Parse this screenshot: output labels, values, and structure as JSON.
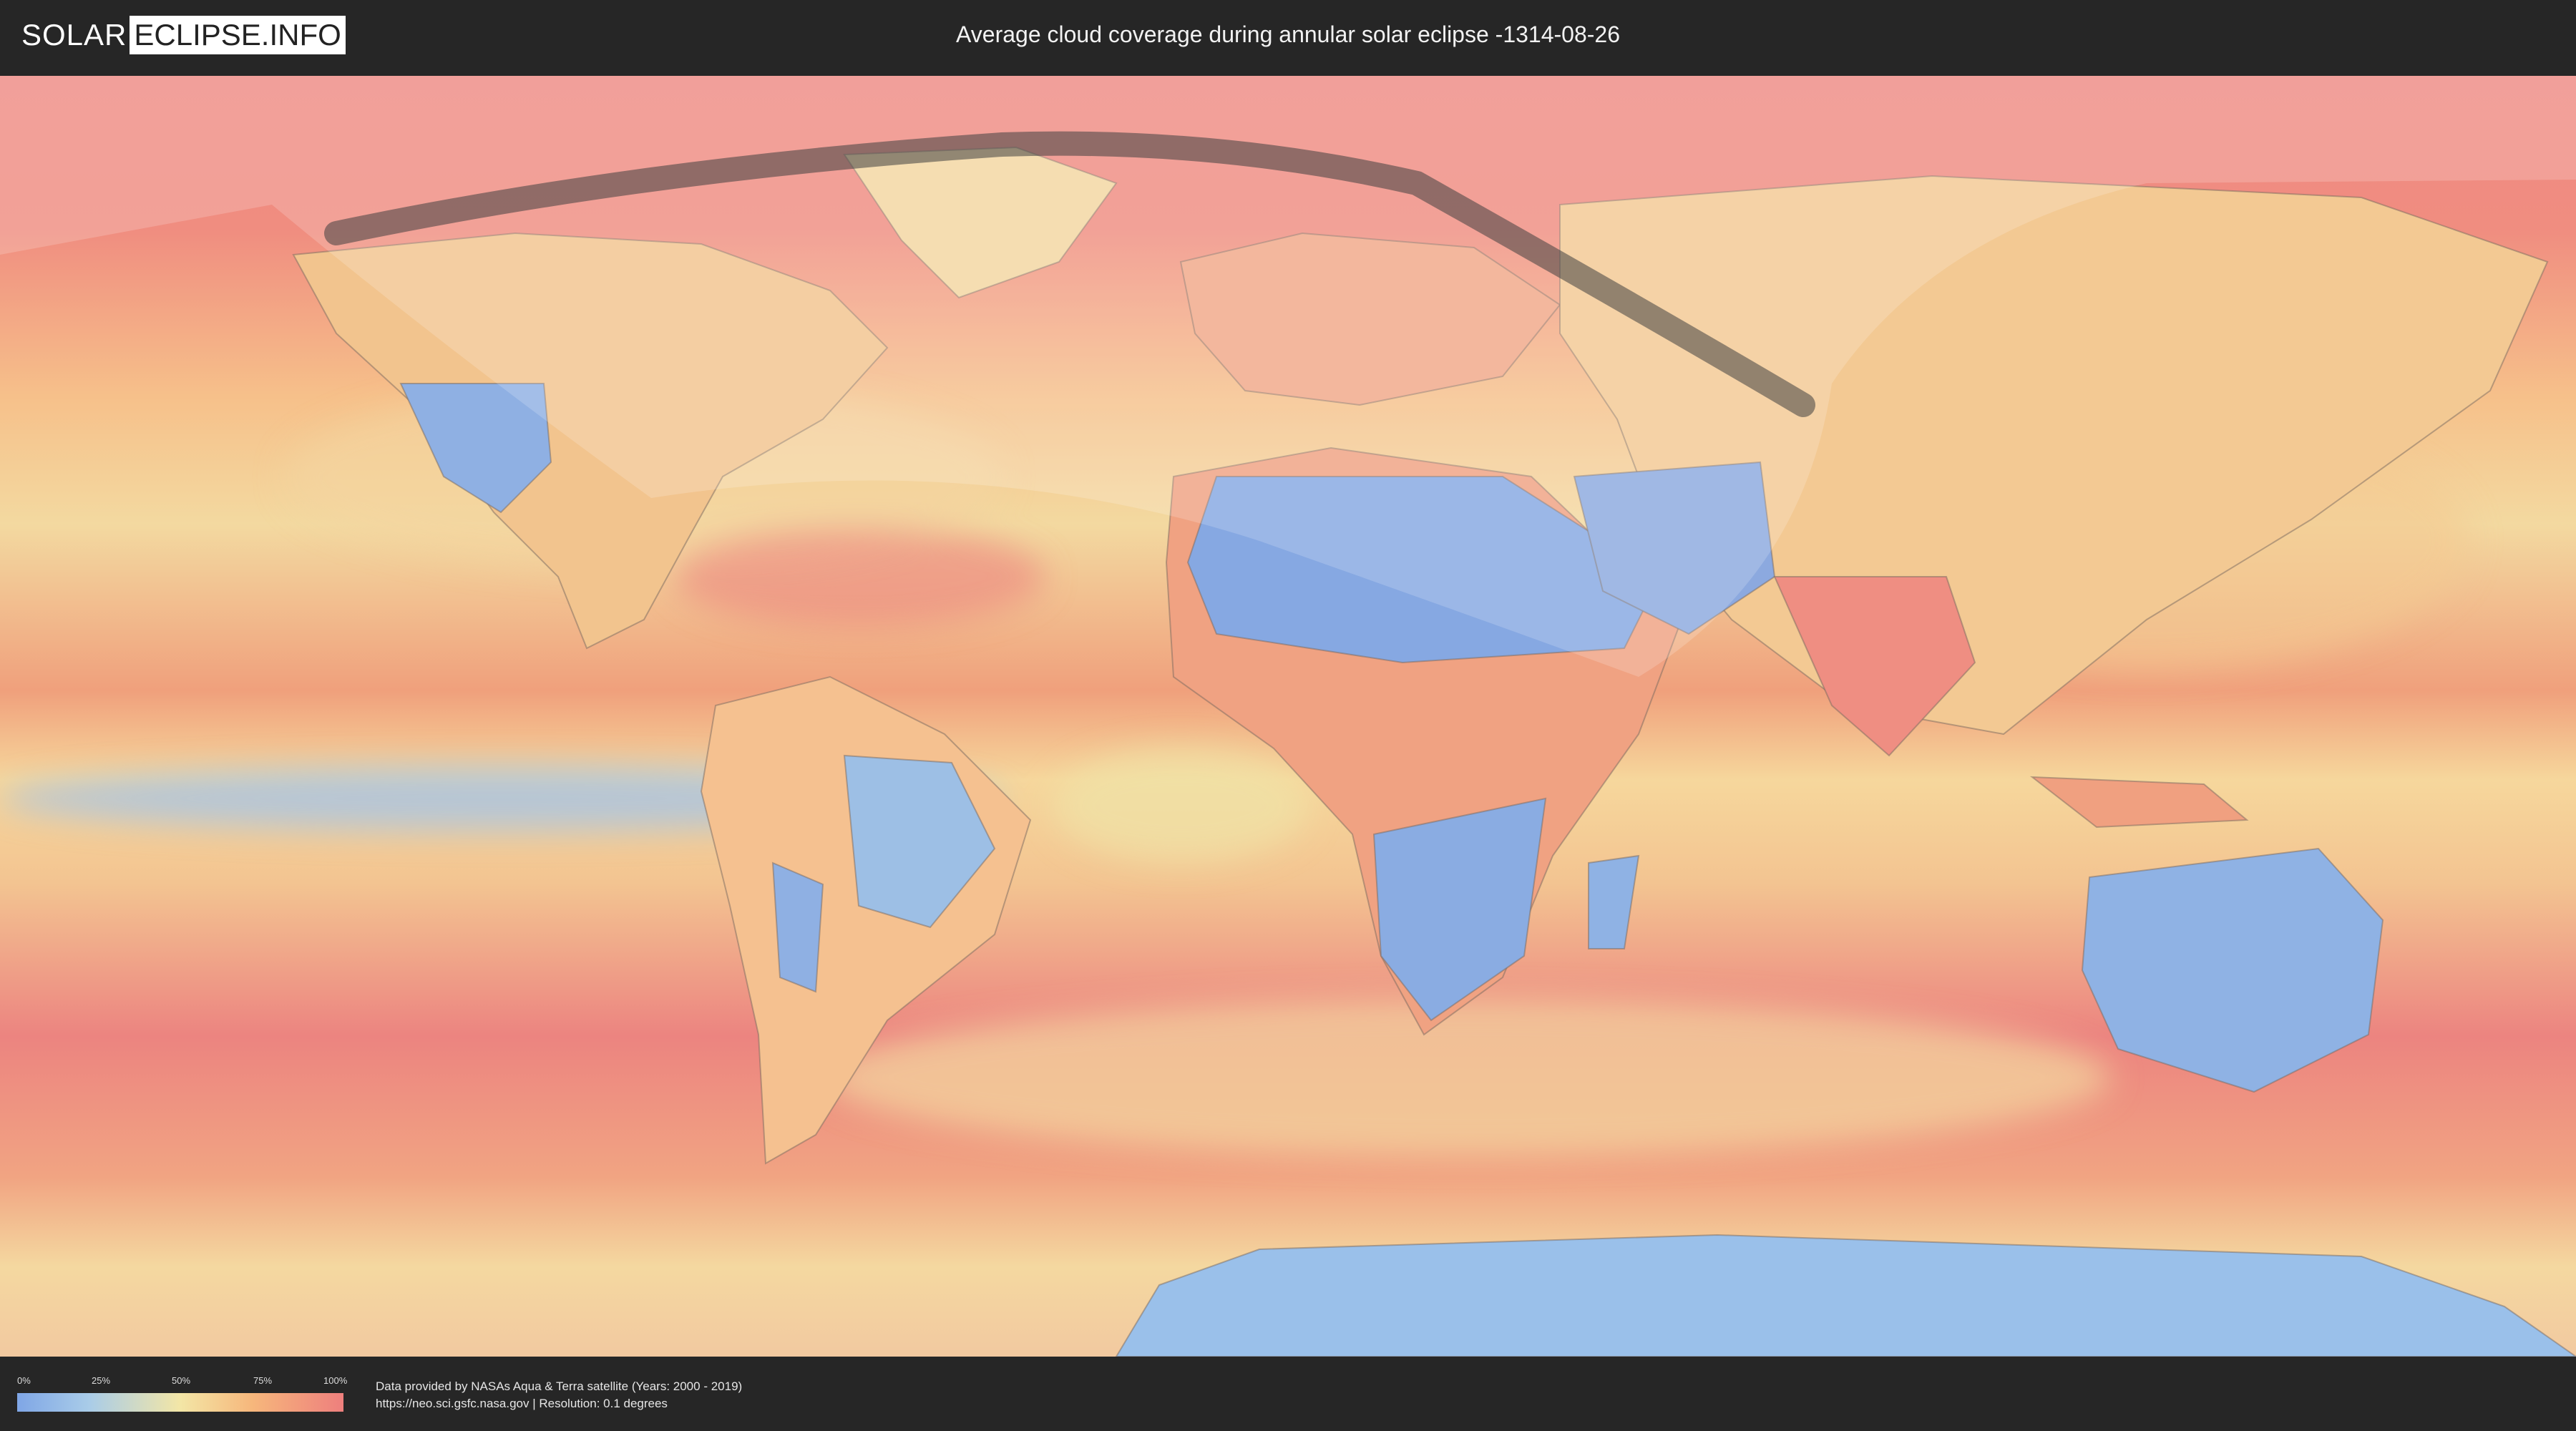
{
  "header": {
    "logo_left": "SOLAR",
    "logo_right": "ECLIPSE.INFO",
    "title": "Average cloud coverage during annular solar eclipse -1314-08-26"
  },
  "legend": {
    "ticks": [
      "0%",
      "25%",
      "50%",
      "75%",
      "100%"
    ],
    "colors": [
      "#7fa6e6",
      "#a9cce8",
      "#f3e6a6",
      "#f6b77c",
      "#ee7f7d"
    ]
  },
  "footer": {
    "credit_line1": "Data provided by NASAs Aqua & Terra satellite (Years: 2000 - 2019)",
    "credit_line2": "https://neo.sci.gsfc.nasa.gov | Resolution: 0.1 degrees"
  },
  "map": {
    "projection": "equirectangular world map",
    "layer": "average cloud coverage",
    "overlay": "eclipse visibility zone and annular path"
  }
}
